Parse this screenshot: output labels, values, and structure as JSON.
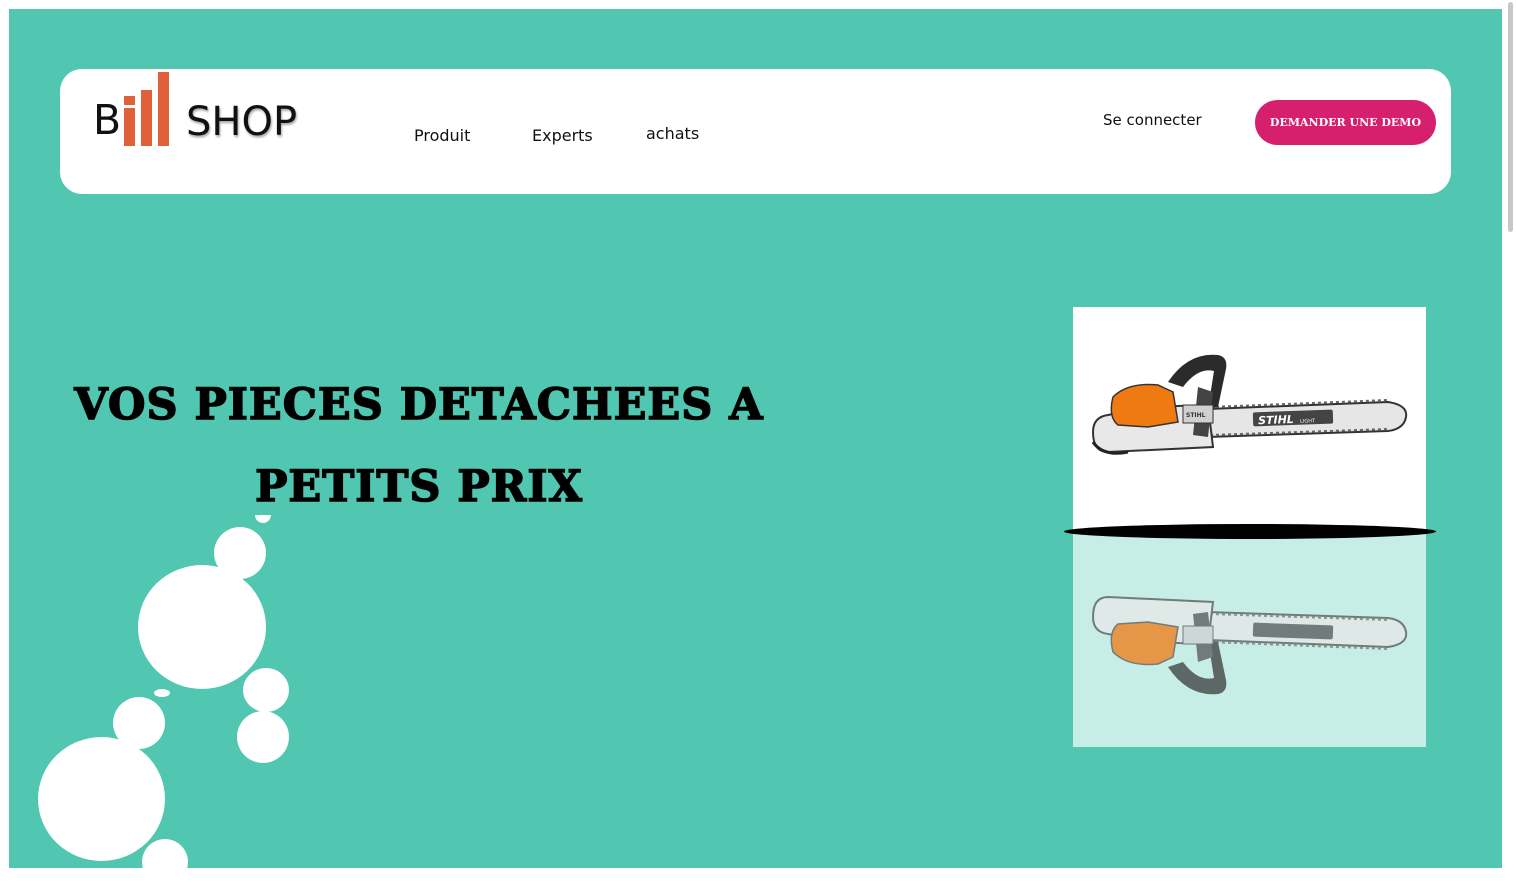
{
  "brand": {
    "logo_letter": "B",
    "logo_word": "SHOP",
    "bar_color": "#e0603a"
  },
  "nav": {
    "links": [
      {
        "label": "Produit"
      },
      {
        "label": "Experts"
      },
      {
        "label": "achats"
      }
    ],
    "login_label": "Se connecter",
    "demo_label": "DEMANDER UNE DEMO"
  },
  "hero": {
    "title_line1": "VOS PIECES DETACHEES A",
    "title_line2": "PETITS PRIX"
  },
  "product": {
    "image_icon": "chainsaw-icon",
    "brand_mark": "STIHL",
    "brand_sub": "LIGHT"
  },
  "colors": {
    "background": "#51c6b0",
    "accent": "#d6206e",
    "reflection": "#c6eee6",
    "saw_orange": "#f07a12"
  }
}
